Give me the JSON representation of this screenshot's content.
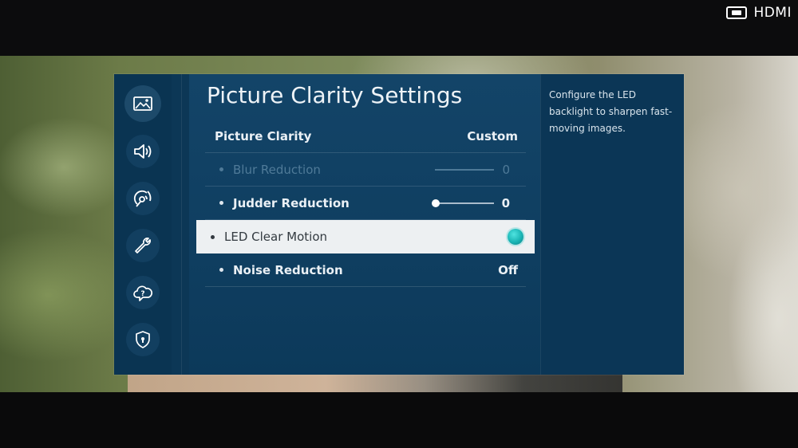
{
  "input_source": {
    "label": "HDMI",
    "icon": "hdmi-port-icon"
  },
  "sidebar": {
    "items": [
      {
        "name": "picture",
        "icon": "picture-icon",
        "active": true
      },
      {
        "name": "sound",
        "icon": "sound-icon",
        "active": false
      },
      {
        "name": "broadcasting",
        "icon": "broadcast-icon",
        "active": false
      },
      {
        "name": "general",
        "icon": "wrench-icon",
        "active": false
      },
      {
        "name": "support",
        "icon": "support-cloud-icon",
        "active": false
      },
      {
        "name": "privacy",
        "icon": "shield-icon",
        "active": false
      }
    ]
  },
  "menu": {
    "title": "Picture Clarity Settings",
    "picture_clarity": {
      "label": "Picture Clarity",
      "value": "Custom"
    },
    "blur_reduction": {
      "label": "Blur Reduction",
      "value": "0",
      "enabled": false,
      "level": 0
    },
    "judder_reduction": {
      "label": "Judder Reduction",
      "value": "0",
      "enabled": true,
      "level": 0
    },
    "led_clear_motion": {
      "label": "LED Clear Motion",
      "on": true
    },
    "noise_reduction": {
      "label": "Noise Reduction",
      "value": "Off"
    }
  },
  "help": {
    "text": "Configure the LED backlight to sharpen fast-moving images."
  },
  "colors": {
    "panel": "#0d3a5a",
    "selected_row": "#edf0f2",
    "toggle_on": "#19b4b4"
  }
}
